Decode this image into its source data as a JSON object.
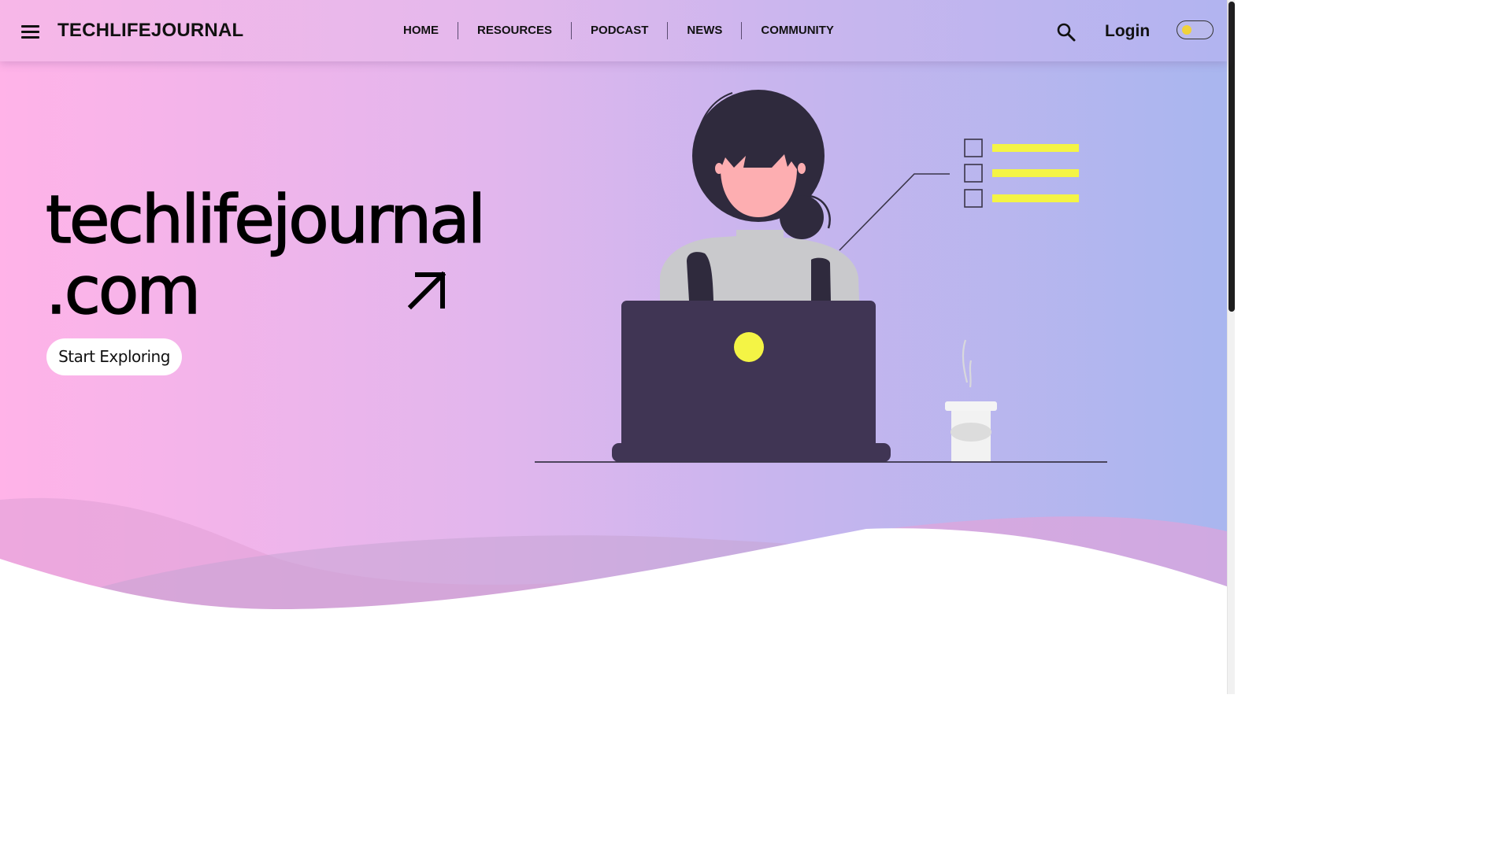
{
  "header": {
    "menu_icon": "hamburger-menu-icon",
    "brand": "TECHLIFEJOURNAL",
    "nav": [
      {
        "label": "HOME"
      },
      {
        "label": "RESOURCES"
      },
      {
        "label": "PODCAST"
      },
      {
        "label": "NEWS"
      },
      {
        "label": "COMMUNITY"
      }
    ],
    "search_icon": "search-icon",
    "login_label": "Login",
    "theme_toggle_icon": "sun-toggle-icon"
  },
  "hero": {
    "title_line1": "techlifejournal",
    "title_line2": ".com",
    "arrow_icon": "arrow-up-right-icon",
    "cta_label": "Start Exploring"
  },
  "colors": {
    "gradient_start": "#ffb3e8",
    "gradient_end": "#a9b6ef",
    "illustration_dark": "#403554",
    "illustration_accent": "#f4f445",
    "skin": "#fdaeb1"
  }
}
